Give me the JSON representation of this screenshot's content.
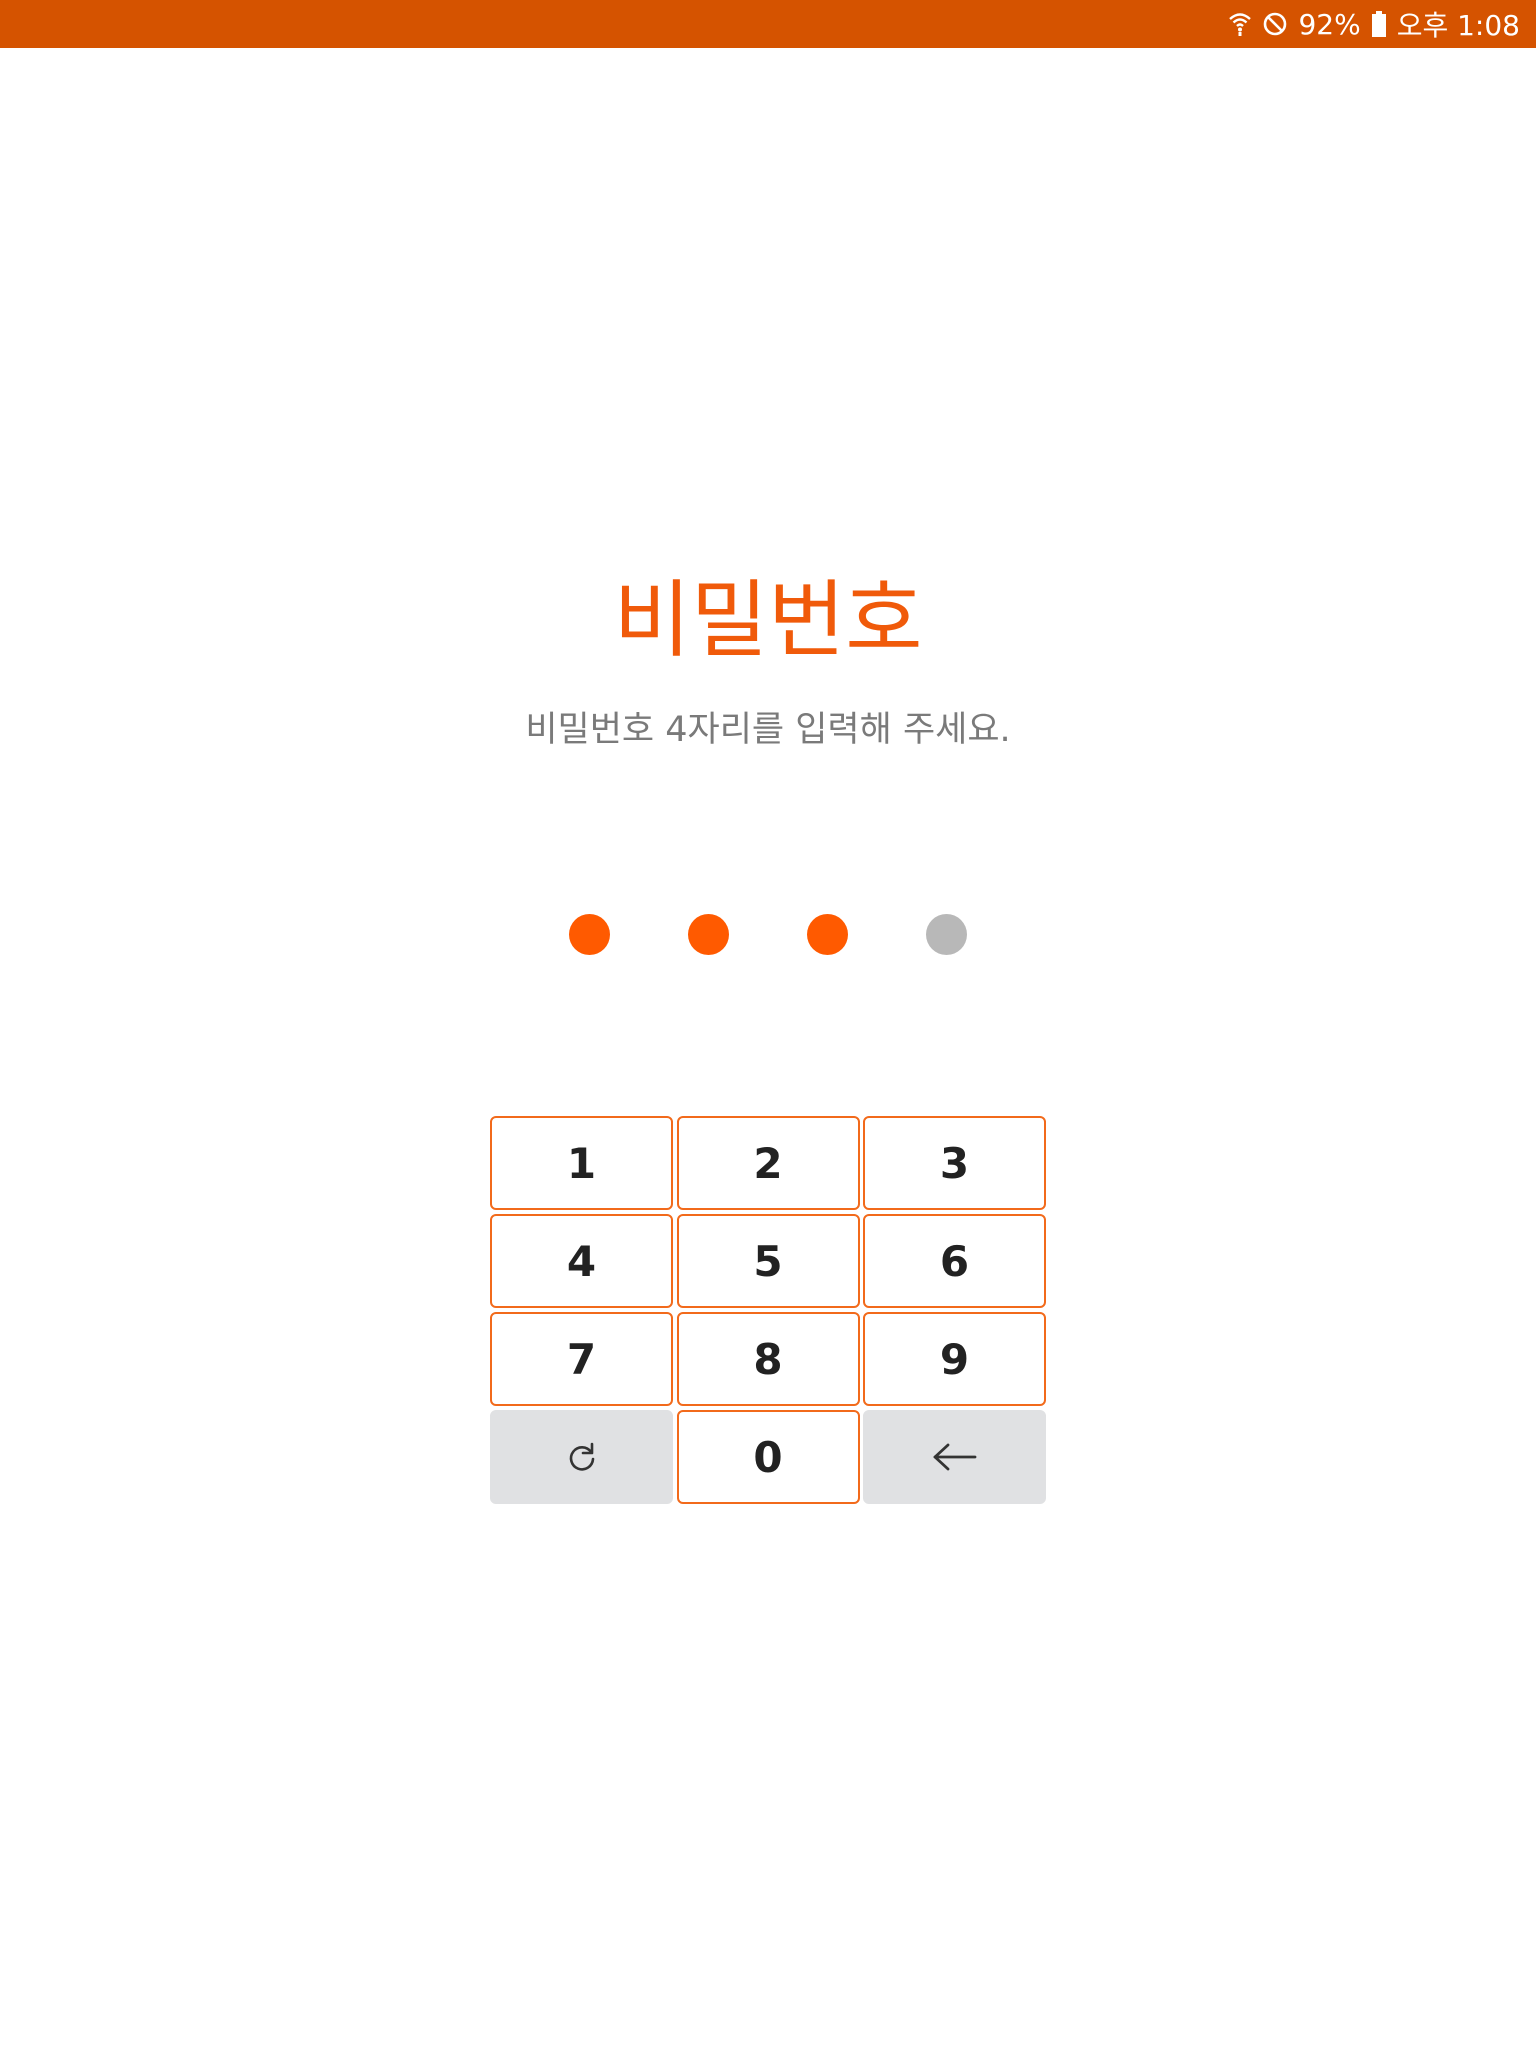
{
  "status_bar": {
    "battery": "92%",
    "time": "오후 1:08",
    "icons": [
      "wifi-icon",
      "do-not-disturb-icon",
      "battery-icon"
    ],
    "background": "#d55300"
  },
  "title": "비밀번호",
  "subtitle": "비밀번호 4자리를 입력해 주세요.",
  "pin": {
    "length": 4,
    "entered": 3,
    "filled_color": "#ff5a00",
    "empty_color": "#b8b8b8"
  },
  "keypad": {
    "keys": [
      "1",
      "2",
      "3",
      "4",
      "5",
      "6",
      "7",
      "8",
      "9",
      "0"
    ],
    "refresh_icon": "refresh-icon",
    "backspace_icon": "arrow-left-icon",
    "accent": "#f26a1b"
  }
}
